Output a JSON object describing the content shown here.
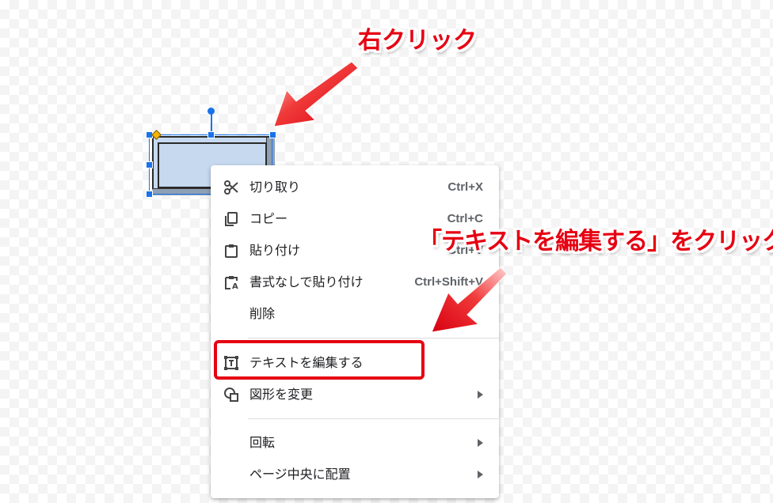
{
  "annotations": {
    "top": "右クリック",
    "middle": "「テキストを編集する」をクリック"
  },
  "colors": {
    "annotation": "#e60012",
    "selection": "#1a73e8",
    "shape_fill": "#c6d9ef",
    "adjust_handle": "#f5b400"
  },
  "context_menu": {
    "items": [
      {
        "id": "cut",
        "label": "切り取り",
        "shortcut": "Ctrl+X",
        "icon": "scissors-icon"
      },
      {
        "id": "copy",
        "label": "コピー",
        "shortcut": "Ctrl+C",
        "icon": "copy-icon"
      },
      {
        "id": "paste",
        "label": "貼り付け",
        "shortcut": "Ctrl+V",
        "icon": "clipboard-icon"
      },
      {
        "id": "paste-plain",
        "label": "書式なしで貼り付け",
        "shortcut": "Ctrl+Shift+V",
        "icon": "paste-plain-icon"
      },
      {
        "id": "delete",
        "label": "削除",
        "shortcut": "",
        "icon": ""
      },
      {
        "id": "edit-text",
        "label": "テキストを編集する",
        "shortcut": "",
        "icon": "text-box-icon"
      },
      {
        "id": "change-shape",
        "label": "図形を変更",
        "shortcut": "",
        "icon": "shapes-icon",
        "submenu": true
      },
      {
        "id": "rotate",
        "label": "回転",
        "shortcut": "",
        "icon": "",
        "submenu": true
      },
      {
        "id": "center-page",
        "label": "ページ中央に配置",
        "shortcut": "",
        "icon": "",
        "submenu": true
      }
    ]
  }
}
